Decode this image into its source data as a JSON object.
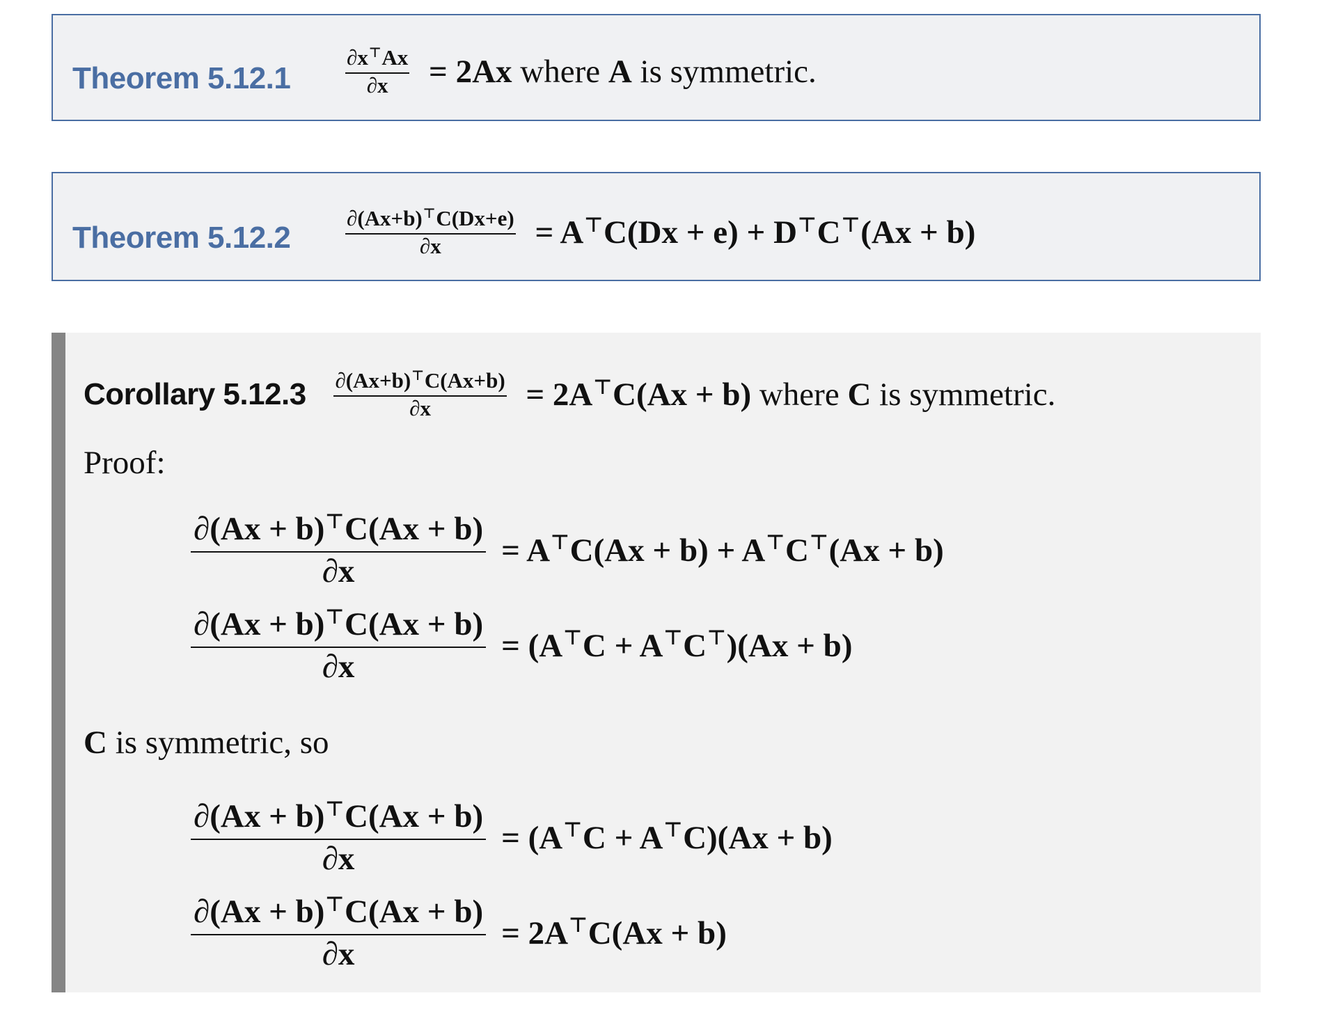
{
  "theorem_1": {
    "label": "Theorem 5.12.1",
    "lhs_num": "∂x⊤Ax",
    "lhs_den": "∂x",
    "equals": "= 2Ax",
    "suffix_1": " where ",
    "matrix": "A",
    "suffix_2": " is symmetric."
  },
  "theorem_2": {
    "label": "Theorem 5.12.2",
    "lhs_num": "∂(Ax+b)⊤C(Dx+e)",
    "lhs_den": "∂x",
    "rhs": "= A⊤C(Dx + e) + D⊤C⊤(Ax + b)"
  },
  "corollary": {
    "label": "Corollary 5.12.3",
    "lhs_num": "∂(Ax+b)⊤C(Ax+b)",
    "lhs_den": "∂x",
    "rhs": "= 2A⊤C(Ax + b)",
    "suffix_1": " where ",
    "matrix": "C",
    "suffix_2": " is symmetric.",
    "proof_label": "Proof:",
    "step_num": "∂(Ax + b)⊤C(Ax + b)",
    "step_den": "∂x",
    "steps_a": [
      "= A⊤C(Ax + b) + A⊤C⊤(Ax + b)",
      "= (A⊤C + A⊤C⊤)(Ax + b)"
    ],
    "middle_matrix": "C",
    "middle_text": " is symmetric, so",
    "steps_b": [
      "= (A⊤C + A⊤C)(Ax + b)",
      "= 2A⊤C(Ax + b)"
    ]
  }
}
